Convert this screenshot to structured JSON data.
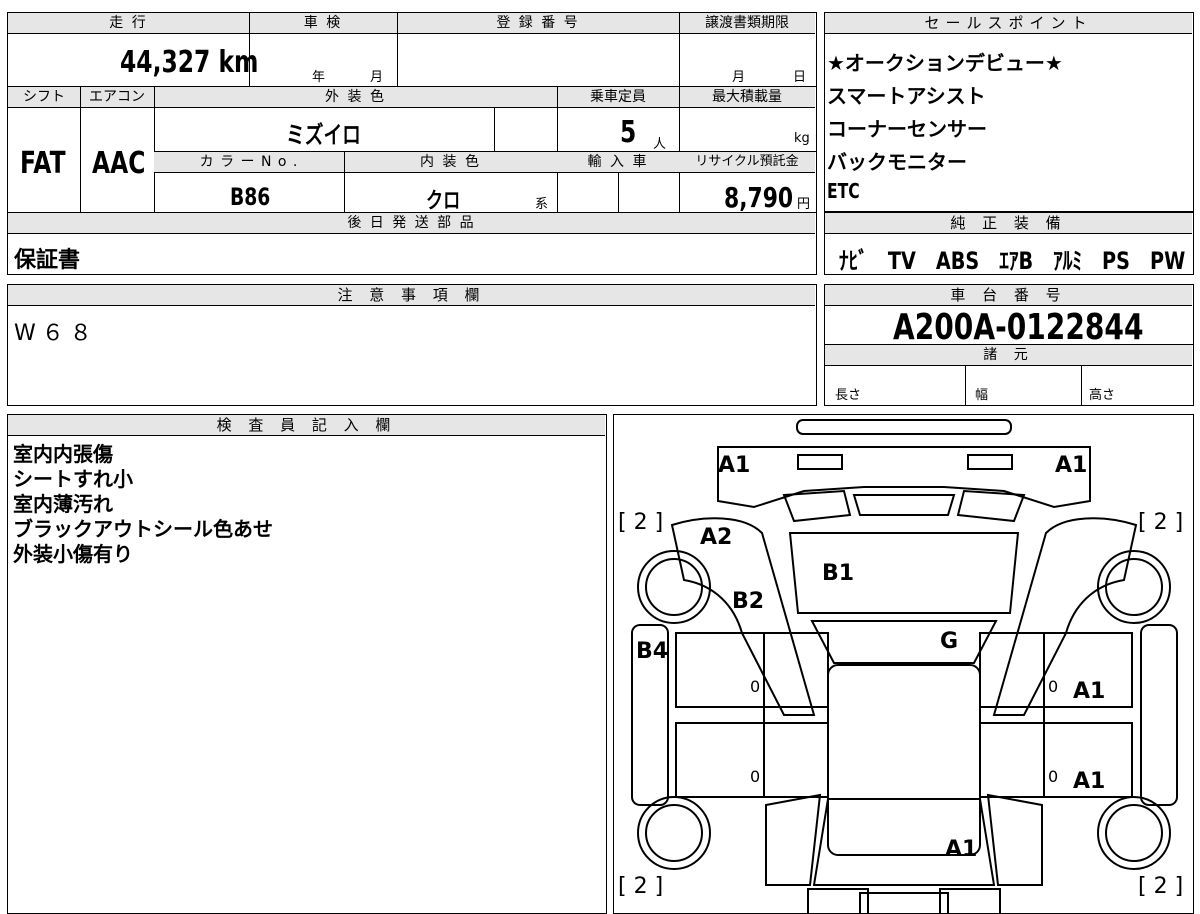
{
  "vehicle": {
    "mileage_label": "走 行",
    "mileage_value": "44,327 km",
    "inspection_label": "車 検",
    "inspection_year": "年",
    "inspection_month": "月",
    "registration_label": "登 録 番 号",
    "transfer_label": "譲渡書類期限",
    "transfer_month": "月",
    "transfer_day": "日",
    "shift_label": "シフト",
    "shift_value": "FAT",
    "ac_label": "エアコン",
    "ac_value": "AAC",
    "exterior_label": "外 装 色",
    "exterior_value": "ミズイロ",
    "capacity_label": "乗車定員",
    "capacity_value": "5",
    "capacity_unit": "人",
    "maxload_label": "最大積載量",
    "maxload_unit": "kg",
    "color_no_label": "カ ラ ー N o .",
    "color_no_value": "B86",
    "interior_label": "内 装 色",
    "interior_value": "クロ",
    "interior_suffix": "系",
    "import_label": "輸 入 車",
    "recycle_label": "リサイクル預託金",
    "recycle_value": "8,790",
    "recycle_unit": "円",
    "later_parts_label": "後 日 発 送 部 品",
    "later_parts_value": "保証書"
  },
  "sales_points": {
    "label": "セールスポイント",
    "items": [
      "★オークションデビュー★",
      "スマートアシスト",
      "コーナーセンサー",
      "バックモニター",
      "ETC"
    ]
  },
  "equipment": {
    "label": "純 正 装 備",
    "items": [
      "ﾅﾋﾞ",
      "TV",
      "ABS",
      "ｴｱB",
      "ｱﾙﾐ",
      "PS",
      "PW"
    ]
  },
  "notes": {
    "label": "注 意 事 項 欄",
    "value": "W６８"
  },
  "chassis": {
    "label": "車 台 番 号",
    "value": "A200A-0122844",
    "specs_label": "諸 元",
    "length_label": "長さ",
    "width_label": "幅",
    "height_label": "高さ"
  },
  "inspector": {
    "label": "検 査 員 記 入 欄",
    "lines": [
      "室内内張傷",
      "シートすれ小",
      "室内薄汚れ",
      "ブラックアウトシール色あせ",
      "外装小傷有り"
    ]
  },
  "diagram": {
    "marks": {
      "front_left": "A1",
      "front_right": "A1",
      "fender_left": "A2",
      "hood": "B1",
      "pillar_left": "B2",
      "side_left": "B4",
      "windshield": "G",
      "door_front_right": "A1",
      "door_rear_right": "A1",
      "rear": "A1"
    },
    "tire_counts": {
      "front_left": "[ 2 ]",
      "front_right": "[ 2 ]",
      "rear_left": "[ 2 ]",
      "rear_right": "[ 2 ]"
    },
    "door_small": {
      "fl": "0",
      "rl": "0",
      "fr": "0",
      "rr": "0"
    }
  }
}
